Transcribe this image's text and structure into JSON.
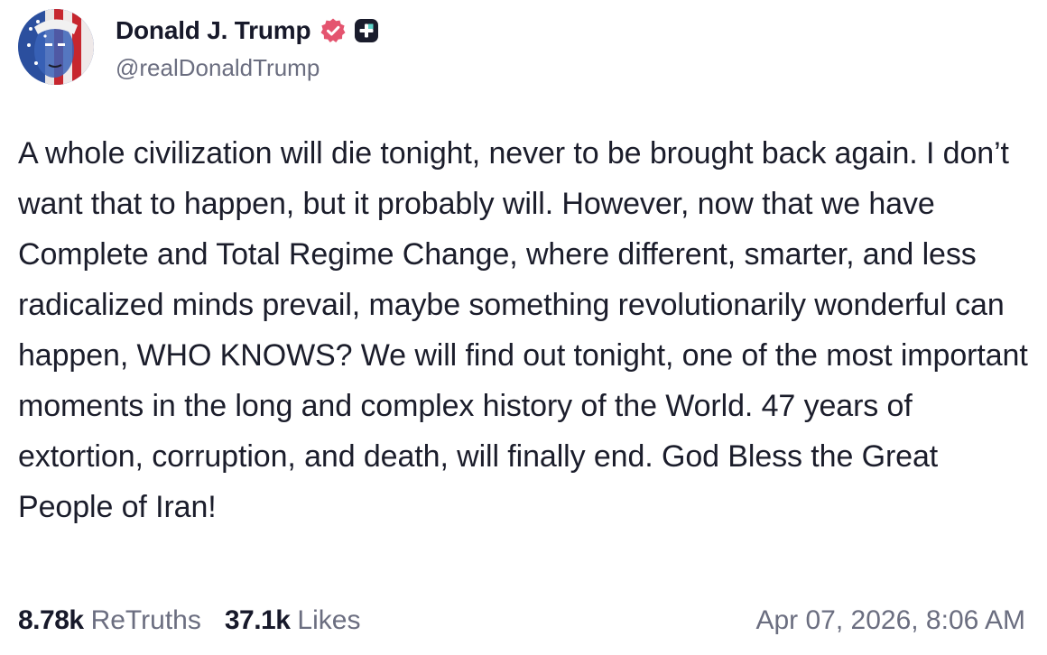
{
  "author": {
    "display_name": "Donald J. Trump",
    "handle": "@realDonaldTrump",
    "verified_icon": "verified-badge-icon",
    "subscription_icon": "plus-icon",
    "colors": {
      "verified": "#e4546f",
      "plus_bg": "#1a1c2c"
    }
  },
  "post": {
    "text": "A whole civilization will die tonight, never to be brought back again. I don’t want that to happen, but it probably will. However, now that we have Complete and Total Regime Change, where different, smarter, and less radicalized minds prevail, maybe something revolutionarily wonderful can happen, WHO KNOWS? We will find out tonight, one of the most important moments in the long and complex history of the World. 47 years of extortion, corruption, and death, will finally end. God Bless the Great People of Iran!"
  },
  "stats": {
    "retruths_count": "8.78k",
    "retruths_label": "ReTruths",
    "likes_count": "37.1k",
    "likes_label": "Likes"
  },
  "timestamp": "Apr 07, 2026, 8:06 AM"
}
